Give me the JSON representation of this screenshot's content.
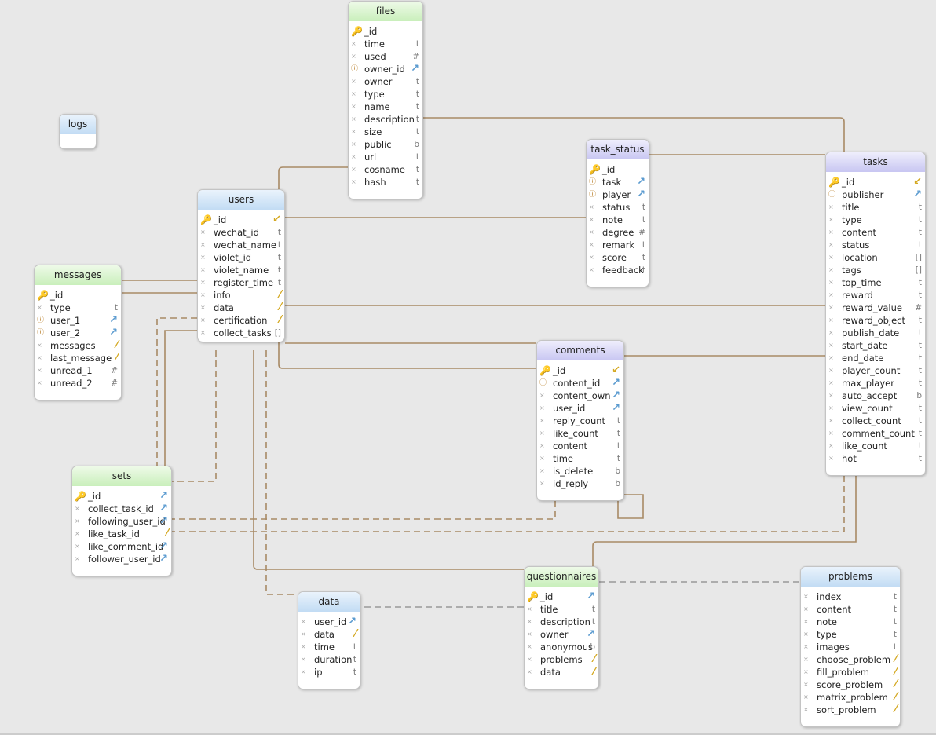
{
  "colors": {
    "line": "#a88a65",
    "dashed_gray": "#999999",
    "header_green": "#c9efbb",
    "header_blue": "#c2dcf4",
    "header_purple": "#c8c6f2"
  },
  "tables": [
    {
      "name": "files",
      "color": "green",
      "fields": [
        [
          "_id",
          "pk",
          ""
        ],
        [
          "time",
          "",
          "t"
        ],
        [
          "used",
          "",
          "#"
        ],
        [
          "owner_id",
          "fk",
          "ref"
        ],
        [
          "owner",
          "",
          "t"
        ],
        [
          "type",
          "",
          "t"
        ],
        [
          "name",
          "",
          "t"
        ],
        [
          "description",
          "",
          "t"
        ],
        [
          "size",
          "",
          "t"
        ],
        [
          "public",
          "",
          "b"
        ],
        [
          "url",
          "",
          "t"
        ],
        [
          "cosname",
          "",
          "t"
        ],
        [
          "hash",
          "",
          "t"
        ]
      ]
    },
    {
      "name": "logs",
      "color": "blue",
      "fields": []
    },
    {
      "name": "task_status",
      "color": "purple",
      "fields": [
        [
          "_id",
          "pk",
          ""
        ],
        [
          "task",
          "fk",
          "ref"
        ],
        [
          "player",
          "fk",
          "ref"
        ],
        [
          "status",
          "",
          "t"
        ],
        [
          "note",
          "",
          "t"
        ],
        [
          "degree",
          "",
          "#"
        ],
        [
          "remark",
          "",
          "t"
        ],
        [
          "score",
          "",
          "t"
        ],
        [
          "feedback",
          "",
          "t"
        ]
      ]
    },
    {
      "name": "tasks",
      "color": "purple",
      "fields": [
        [
          "_id",
          "pk",
          "back"
        ],
        [
          "publisher",
          "fk",
          "ref"
        ],
        [
          "title",
          "",
          "t"
        ],
        [
          "type",
          "",
          "t"
        ],
        [
          "content",
          "",
          "t"
        ],
        [
          "status",
          "",
          "t"
        ],
        [
          "location",
          "",
          "[]"
        ],
        [
          "tags",
          "",
          "[]"
        ],
        [
          "top_time",
          "",
          "t"
        ],
        [
          "reward",
          "",
          "t"
        ],
        [
          "reward_value",
          "",
          "#"
        ],
        [
          "reward_object",
          "",
          "t"
        ],
        [
          "publish_date",
          "",
          "t"
        ],
        [
          "start_date",
          "",
          "t"
        ],
        [
          "end_date",
          "",
          "t"
        ],
        [
          "player_count",
          "",
          "t"
        ],
        [
          "max_player",
          "",
          "t"
        ],
        [
          "auto_accept",
          "",
          "b"
        ],
        [
          "view_count",
          "",
          "t"
        ],
        [
          "collect_count",
          "",
          "t"
        ],
        [
          "comment_count",
          "",
          "t"
        ],
        [
          "like_count",
          "",
          "t"
        ],
        [
          "hot",
          "",
          "t"
        ]
      ]
    },
    {
      "name": "users",
      "color": "blue",
      "fields": [
        [
          "_id",
          "pk",
          "back"
        ],
        [
          "wechat_id",
          "",
          "t"
        ],
        [
          "wechat_name",
          "",
          "t"
        ],
        [
          "violet_id",
          "",
          "t"
        ],
        [
          "violet_name",
          "",
          "t"
        ],
        [
          "register_time",
          "",
          "t"
        ],
        [
          "info",
          "",
          "obj"
        ],
        [
          "data",
          "",
          "obj"
        ],
        [
          "certification",
          "",
          "obj"
        ],
        [
          "collect_tasks",
          "",
          "[]"
        ]
      ]
    },
    {
      "name": "messages",
      "color": "green",
      "fields": [
        [
          "_id",
          "pk",
          ""
        ],
        [
          "type",
          "",
          "t"
        ],
        [
          "user_1",
          "fk",
          "ref"
        ],
        [
          "user_2",
          "fk",
          "ref"
        ],
        [
          "messages",
          "",
          "obj"
        ],
        [
          "last_message",
          "",
          "obj"
        ],
        [
          "unread_1",
          "",
          "#"
        ],
        [
          "unread_2",
          "",
          "#"
        ]
      ]
    },
    {
      "name": "comments",
      "color": "purple",
      "fields": [
        [
          "_id",
          "pk",
          "back"
        ],
        [
          "content_id",
          "fk",
          "ref"
        ],
        [
          "content_own",
          "",
          "ref"
        ],
        [
          "user_id",
          "",
          "ref"
        ],
        [
          "reply_count",
          "",
          "t"
        ],
        [
          "like_count",
          "",
          "t"
        ],
        [
          "content",
          "",
          "t"
        ],
        [
          "time",
          "",
          "t"
        ],
        [
          "is_delete",
          "",
          "b"
        ],
        [
          "id_reply",
          "",
          "b"
        ]
      ]
    },
    {
      "name": "sets",
      "color": "green",
      "fields": [
        [
          "_id",
          "pk",
          "ref"
        ],
        [
          "collect_task_id",
          "",
          "ref"
        ],
        [
          "following_user_id",
          "",
          "ref"
        ],
        [
          "like_task_id",
          "",
          "obj"
        ],
        [
          "like_comment_id",
          "",
          "ref"
        ],
        [
          "follower_user_id",
          "",
          "ref"
        ]
      ]
    },
    {
      "name": "questionnaires",
      "color": "green",
      "fields": [
        [
          "_id",
          "pk",
          "ref"
        ],
        [
          "title",
          "",
          "t"
        ],
        [
          "description",
          "",
          "t"
        ],
        [
          "owner",
          "",
          "ref"
        ],
        [
          "anonymous",
          "",
          "b"
        ],
        [
          "problems",
          "",
          "obj"
        ],
        [
          "data",
          "",
          "obj"
        ]
      ]
    },
    {
      "name": "data",
      "color": "blue",
      "fields": [
        [
          "user_id",
          "",
          "ref"
        ],
        [
          "data",
          "",
          "obj"
        ],
        [
          "time",
          "",
          "t"
        ],
        [
          "duration",
          "",
          "t"
        ],
        [
          "ip",
          "",
          "t"
        ]
      ]
    },
    {
      "name": "problems",
      "color": "blue",
      "fields": [
        [
          "index",
          "",
          "t"
        ],
        [
          "content",
          "",
          "t"
        ],
        [
          "note",
          "",
          "t"
        ],
        [
          "type",
          "",
          "t"
        ],
        [
          "images",
          "",
          "t"
        ],
        [
          "choose_problem",
          "",
          "obj"
        ],
        [
          "fill_problem",
          "",
          "obj"
        ],
        [
          "score_problem",
          "",
          "obj"
        ],
        [
          "matrix_problem",
          "",
          "obj"
        ],
        [
          "sort_problem",
          "",
          "obj"
        ]
      ]
    }
  ]
}
